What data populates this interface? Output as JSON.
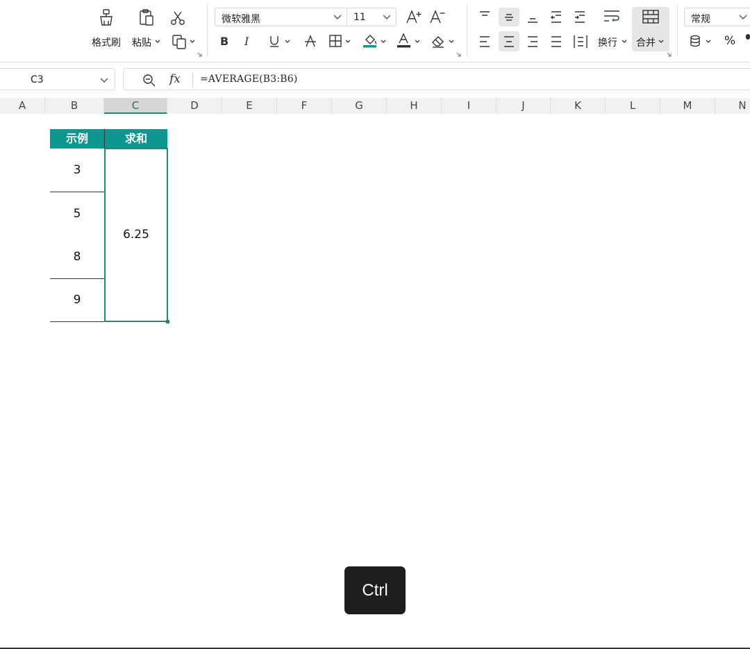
{
  "ribbon": {
    "format_painter_label": "格式刷",
    "paste_label": "粘贴",
    "font_name": "微软雅黑",
    "font_size": "11",
    "wrap_label": "换行",
    "merge_label": "合并",
    "number_format": "常规",
    "percent_label": "%"
  },
  "name_box": {
    "value": "C3"
  },
  "formula_bar": {
    "fx_label": "fx",
    "formula": "=AVERAGE(B3:B6)"
  },
  "columns": [
    "A",
    "B",
    "C",
    "D",
    "E",
    "F",
    "G",
    "H",
    "I",
    "J",
    "K",
    "L",
    "M",
    "N"
  ],
  "selected_column": "C",
  "table": {
    "headers": [
      "示例",
      "求和"
    ],
    "b_values": [
      "3",
      "5",
      "8",
      "9"
    ],
    "c_merged_value": "6.25"
  },
  "key_overlay": {
    "label": "Ctrl"
  },
  "colors": {
    "accent_teal": "#0f9690",
    "selection_green": "#1e8c68"
  }
}
